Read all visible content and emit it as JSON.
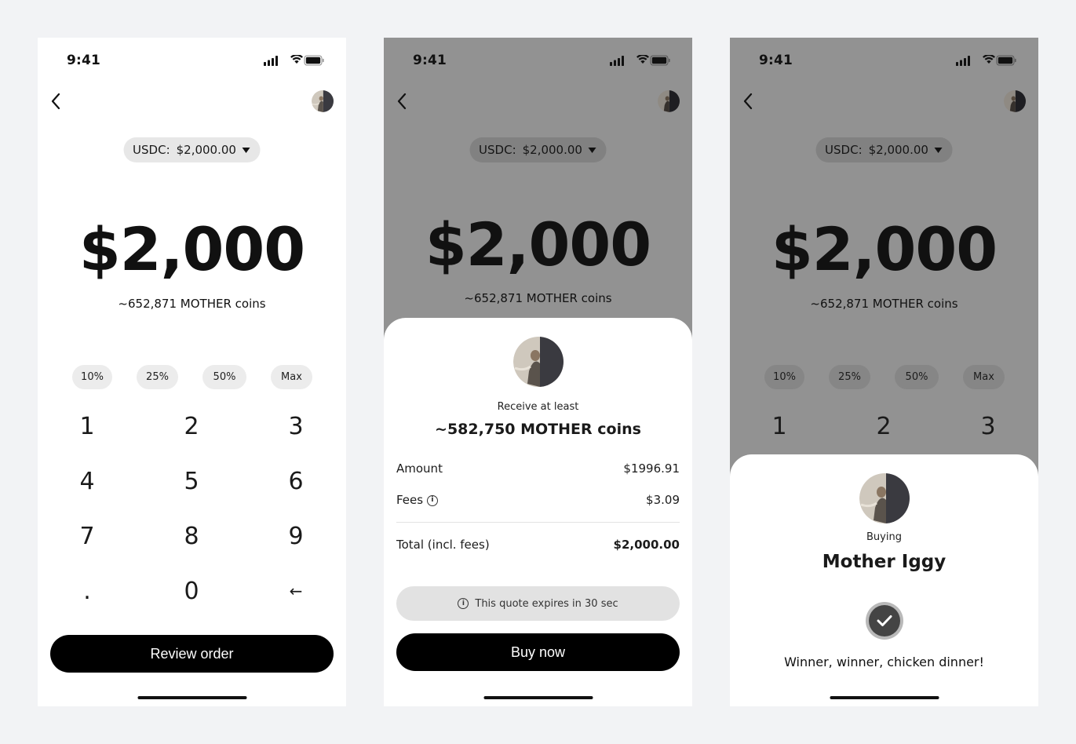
{
  "status_bar": {
    "time": "9:41",
    "icons": [
      "signal-icon",
      "wifi-icon",
      "battery-icon"
    ]
  },
  "token_selector": {
    "label": "USDC:",
    "value": "$2,000.00"
  },
  "amount": {
    "display": "$2,000",
    "coins_estimate": "~652,871 MOTHER coins"
  },
  "percent_chips": [
    "10%",
    "25%",
    "50%",
    "Max"
  ],
  "keypad": [
    "1",
    "2",
    "3",
    "4",
    "5",
    "6",
    "7",
    "8",
    "9",
    ".",
    "0",
    "←"
  ],
  "review_button": "Review order",
  "review_sheet": {
    "receive_caption": "Receive at least",
    "receive_amount": "~582,750 MOTHER coins",
    "amount_label": "Amount",
    "amount_value": "$1996.91",
    "fees_label": "Fees",
    "fees_value": "$3.09",
    "total_label": "Total (incl. fees)",
    "total_value": "$2,000.00",
    "quote_notice": "This quote expires in 30 sec",
    "buy_button": "Buy now"
  },
  "success_sheet": {
    "caption": "Buying",
    "name": "Mother Iggy",
    "message": "Winner, winner, chicken dinner!"
  },
  "colors": {
    "primary_button": "#000000",
    "overlay": "#929292",
    "background": "#f2f3f5"
  }
}
